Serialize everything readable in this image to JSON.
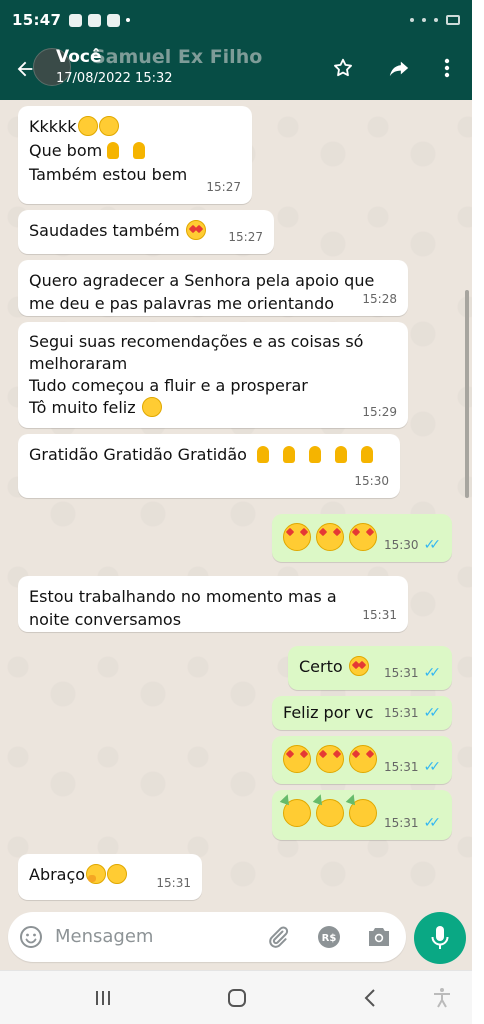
{
  "status": {
    "time": "15:47"
  },
  "header": {
    "name_overlay": "Samuel Ex Filho",
    "sender": "Você",
    "date": "17/08/2022 15:32"
  },
  "messages": [
    {
      "dir": "in",
      "lines": [
        "Kkkkk",
        "Que bom",
        "Também estou bem"
      ],
      "time": "15:27"
    },
    {
      "dir": "in",
      "text": "Saudades também",
      "time": "15:27"
    },
    {
      "dir": "in",
      "text": "Quero agradecer a Senhora pela apoio que me deu e pas palavras me orientando",
      "time": "15:28"
    },
    {
      "dir": "in",
      "lines": [
        "Segui suas recomendações  e as coisas só melhoraram",
        "Tudo começou a fluir e a prosperar",
        "Tô muito feliz"
      ],
      "time": "15:29"
    },
    {
      "dir": "in",
      "text": "Gratidão Gratidão Gratidão",
      "time": "15:30"
    },
    {
      "dir": "out",
      "text": "",
      "time": "15:30"
    },
    {
      "dir": "in",
      "text": "Estou trabalhando no momento mas a noite conversamos",
      "time": "15:31"
    },
    {
      "dir": "out",
      "text": "Certo",
      "time": "15:31"
    },
    {
      "dir": "out",
      "text": "Feliz por vc",
      "time": "15:31"
    },
    {
      "dir": "out",
      "text": "",
      "time": "15:31"
    },
    {
      "dir": "out",
      "text": "",
      "time": "15:31"
    },
    {
      "dir": "in",
      "text": "Abraço",
      "time": "15:31"
    }
  ],
  "input": {
    "placeholder": "Mensagem",
    "currency_label": "R$"
  },
  "icons": {
    "back": "back-arrow-icon",
    "star": "star-icon",
    "forward": "forward-icon",
    "more": "more-vert-icon",
    "emoji": "emoji-icon",
    "attach": "paperclip-icon",
    "camera": "camera-icon",
    "mic": "mic-icon"
  },
  "colors": {
    "header": "#074d45",
    "incoming": "#ffffff",
    "outgoing": "#dcf8c6",
    "accent": "#0aa884",
    "read_ticks": "#34b7f1"
  }
}
